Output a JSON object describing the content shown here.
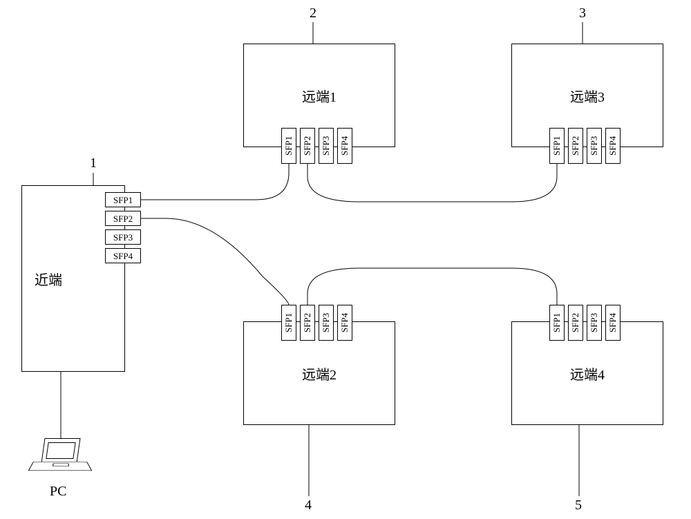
{
  "markers": {
    "m1": "1",
    "m2": "2",
    "m3": "3",
    "m4": "4",
    "m5": "5"
  },
  "nodes": {
    "near": {
      "label": "近端"
    },
    "remote1": {
      "label": "远端1"
    },
    "remote2": {
      "label": "远端2"
    },
    "remote3": {
      "label": "远端3"
    },
    "remote4": {
      "label": "远端4"
    }
  },
  "sfp": {
    "p1": "SFP1",
    "p2": "SFP2",
    "p3": "SFP3",
    "p4": "SFP4"
  },
  "pc_label": "PC",
  "chart_data": {
    "type": "diagram",
    "nodes": [
      {
        "id": "PC",
        "label": "PC"
      },
      {
        "id": "near",
        "label": "近端",
        "ports": [
          "SFP1",
          "SFP2",
          "SFP3",
          "SFP4"
        ]
      },
      {
        "id": "remote1",
        "label": "远端1",
        "ports": [
          "SFP1",
          "SFP2",
          "SFP3",
          "SFP4"
        ]
      },
      {
        "id": "remote2",
        "label": "远端2",
        "ports": [
          "SFP1",
          "SFP2",
          "SFP3",
          "SFP4"
        ]
      },
      {
        "id": "remote3",
        "label": "远端3",
        "ports": [
          "SFP1",
          "SFP2",
          "SFP3",
          "SFP4"
        ]
      },
      {
        "id": "remote4",
        "label": "远端4",
        "ports": [
          "SFP1",
          "SFP2",
          "SFP3",
          "SFP4"
        ]
      }
    ],
    "edges": [
      {
        "from": "PC",
        "to": "near"
      },
      {
        "from": "near",
        "from_port": "SFP1",
        "to": "remote1",
        "to_port": "SFP1"
      },
      {
        "from": "near",
        "from_port": "SFP2",
        "to": "remote2",
        "to_port": "SFP1"
      },
      {
        "from": "remote1",
        "from_port": "SFP2",
        "to": "remote3",
        "to_port": "SFP1"
      },
      {
        "from": "remote2",
        "from_port": "SFP2",
        "to": "remote4",
        "to_port": "SFP1"
      }
    ],
    "markers": {
      "1": "near",
      "2": "remote1",
      "3": "remote3",
      "4": "remote2",
      "5": "remote4"
    }
  }
}
